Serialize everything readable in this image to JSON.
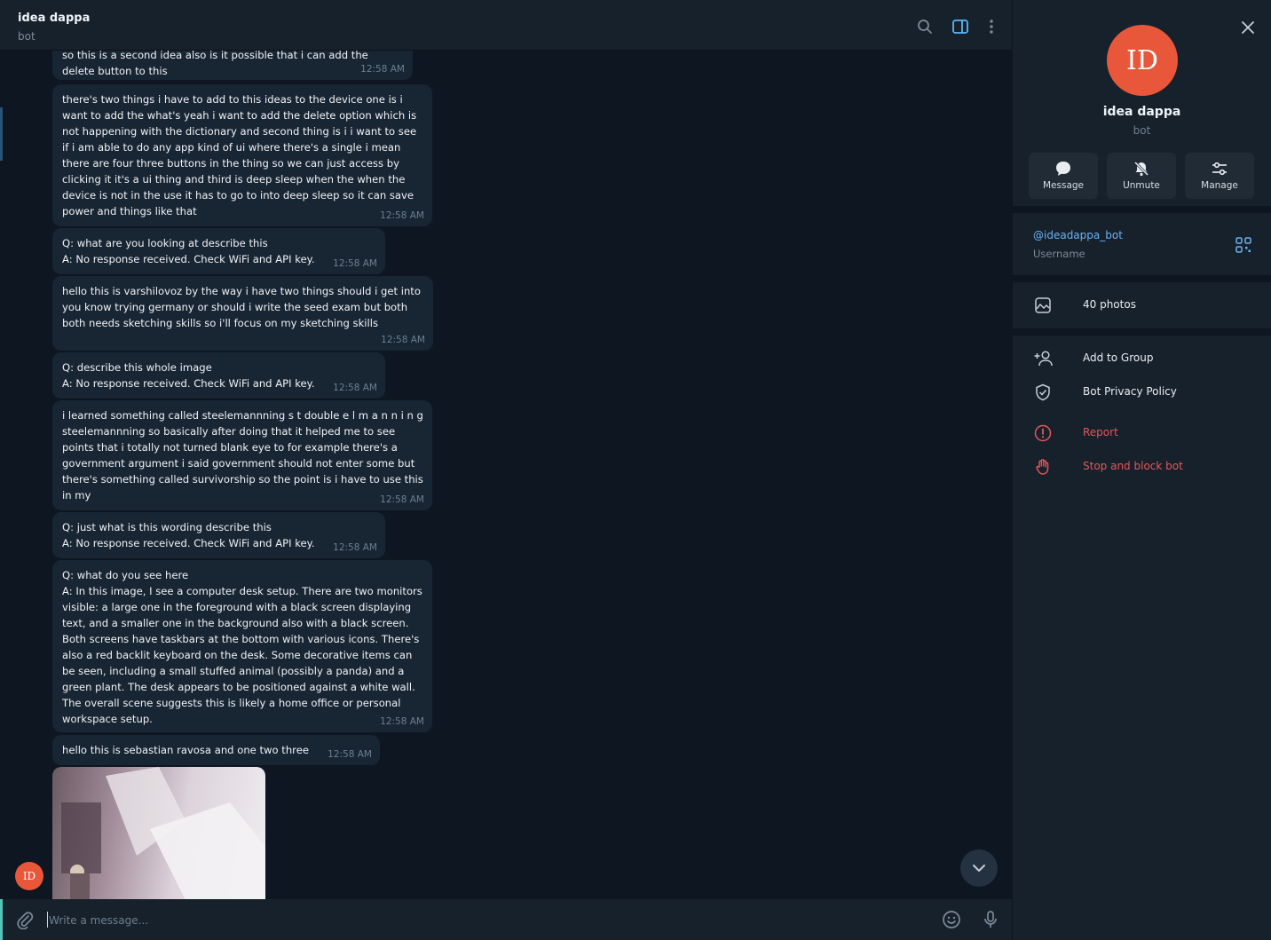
{
  "header": {
    "title": "idea dappa",
    "subtitle": "bot"
  },
  "messages": [
    {
      "text": "so this is a second idea also is it possible that i can add the delete button to this",
      "time": "12:58 AM"
    },
    {
      "text": "there's two things i have to add to this ideas to the device one is i want to add the what's yeah i want to add the delete option which is not happening with the dictionary and second thing is i i want to see if i am able to do any app kind of ui where there's a single i mean there are four three buttons in the thing so we can just access by clicking it it's a ui thing and third is deep sleep when the when the device is not in the use it has to go to into deep sleep so it can save power and things like that",
      "time": "12:58 AM"
    },
    {
      "text": "Q: what are you looking at describe this\nA: No response received. Check WiFi and API key.",
      "time": "12:58 AM"
    },
    {
      "text": "hello this is varshilovoz by the way i have two things should i get into you know trying germany or should i write the seed exam but both both needs sketching skills so i'll focus on my sketching skills",
      "time": "12:58 AM"
    },
    {
      "text": "Q: describe this whole image\nA: No response received. Check WiFi and API key.",
      "time": "12:58 AM"
    },
    {
      "text": "i learned something called steelemannning s t double e l m a n n i n g steelemannning so basically after doing that it helped me to see points that i totally not turned blank eye to for example there's a government argument i said government should not enter some but there's something called survivorship so the point is i have to use this in my",
      "time": "12:58 AM"
    },
    {
      "text": "Q: just what is this wording describe this\nA: No response received. Check WiFi and API key.",
      "time": "12:58 AM"
    },
    {
      "text": "Q: what do you see here\nA: In this image, I see a computer desk setup. There are two monitors visible: a large one in the foreground with a black screen displaying text, and a smaller one in the background also with a black screen. Both screens have taskbars at the bottom with various icons. There's also a red backlit keyboard on the desk. Some decorative items can be seen, including a small stuffed animal (possibly a panda) and a green plant. The desk appears to be positioned against a white wall. The overall scene suggests this is likely a home office or personal workspace setup.",
      "time": "12:58 AM"
    },
    {
      "text": "hello this is sebastian ravosa and one two three",
      "time": "12:58 AM"
    }
  ],
  "avatar_initials": "ID",
  "composer": {
    "placeholder": "Write a message..."
  },
  "panel": {
    "initials": "ID",
    "name": "idea dappa",
    "subtitle": "bot",
    "actions": [
      {
        "label": "Message",
        "icon": "message-icon"
      },
      {
        "label": "Unmute",
        "icon": "bell-off-icon"
      },
      {
        "label": "Manage",
        "icon": "sliders-icon"
      }
    ],
    "username": "@ideadappa_bot",
    "username_label": "Username",
    "photos_label": "40 photos",
    "add_to_group": "Add to Group",
    "privacy_policy": "Bot Privacy Policy",
    "report": "Report",
    "stop_block": "Stop and block bot"
  },
  "colors": {
    "accent": "#6ab3f3",
    "danger": "#e8555a",
    "avatar": "#e8573a",
    "bubble": "#182533"
  }
}
